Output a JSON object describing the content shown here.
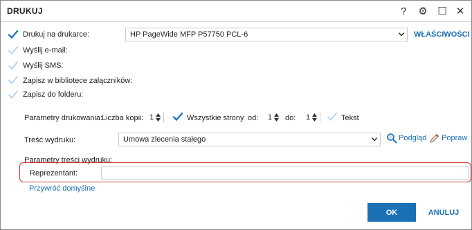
{
  "window": {
    "title": "DRUKUJ"
  },
  "titlebar": {
    "help_glyph": "?",
    "settings_glyph": "⚙",
    "maximize_glyph": "☐",
    "close_glyph": "✕"
  },
  "options": {
    "print_on_printer": {
      "label": "Drukuj na drukarce:",
      "checked": true
    },
    "send_email": {
      "label": "Wyślij e-mail:",
      "checked": false
    },
    "send_sms": {
      "label": "Wyślij SMS:",
      "checked": false
    },
    "save_attachments": {
      "label": "Zapisz w bibliotece załączników:",
      "checked": false
    },
    "save_folder": {
      "label": "Zapisz do folderu:",
      "checked": false
    }
  },
  "printer": {
    "selected": "HP PageWide MFP P57750 PCL-6",
    "properties_label": "WŁAŚCIWOŚCI"
  },
  "print_params": {
    "label": "Parametry drukowania:",
    "copies_label": "Liczba kopii:",
    "copies": "1",
    "all_pages_label": "Wszystkie strony",
    "all_pages_checked": true,
    "from_label": "od:",
    "from_value": "1",
    "to_label": "do:",
    "to_value": "1",
    "text_label": "Tekst",
    "text_checked": false
  },
  "content": {
    "label": "Treść wydruku:",
    "selected": "Umowa zlecenia stałego",
    "preview_label": "Podgląd",
    "edit_label": "Popraw"
  },
  "content_params": {
    "label": "Parametry treści wydruku:",
    "representative_label": "Reprezentant:",
    "representative_value": "",
    "restore_defaults_label": "Przywróć domyślne"
  },
  "actions": {
    "ok_label": "OK",
    "cancel_label": "ANULUJ"
  },
  "colors": {
    "accent": "#1b6fb5",
    "check": "#1b78c8",
    "check_faded": "#b9d4ec",
    "highlight": "#d83030"
  }
}
